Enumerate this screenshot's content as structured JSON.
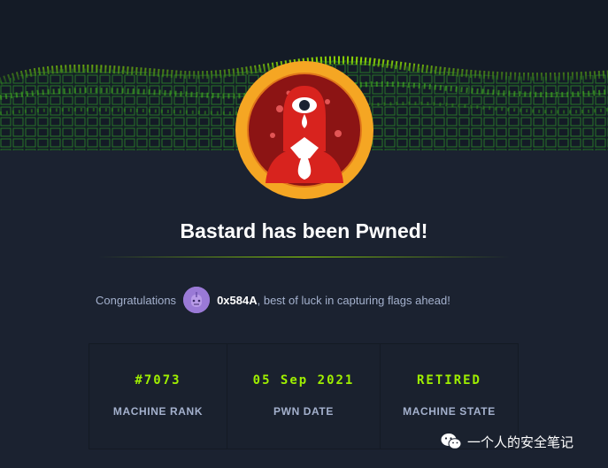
{
  "page": {
    "title": "Bastard has been Pwned!"
  },
  "congrats": {
    "prefix": "Congratulations",
    "username": "0x584A",
    "suffix": ", best of luck in capturing flags ahead!"
  },
  "stats": [
    {
      "value": "#7073",
      "label": "MACHINE RANK"
    },
    {
      "value": "05 Sep 2021",
      "label": "PWN DATE"
    },
    {
      "value": "RETIRED",
      "label": "MACHINE STATE"
    }
  ],
  "watermark": {
    "text": "一个人的安全笔记"
  },
  "colors": {
    "background": "#1b2230",
    "accent_green": "#9fef00",
    "muted_text": "#a4b1cd",
    "badge_ring": "#f5a623",
    "badge_red": "#d8231e"
  }
}
